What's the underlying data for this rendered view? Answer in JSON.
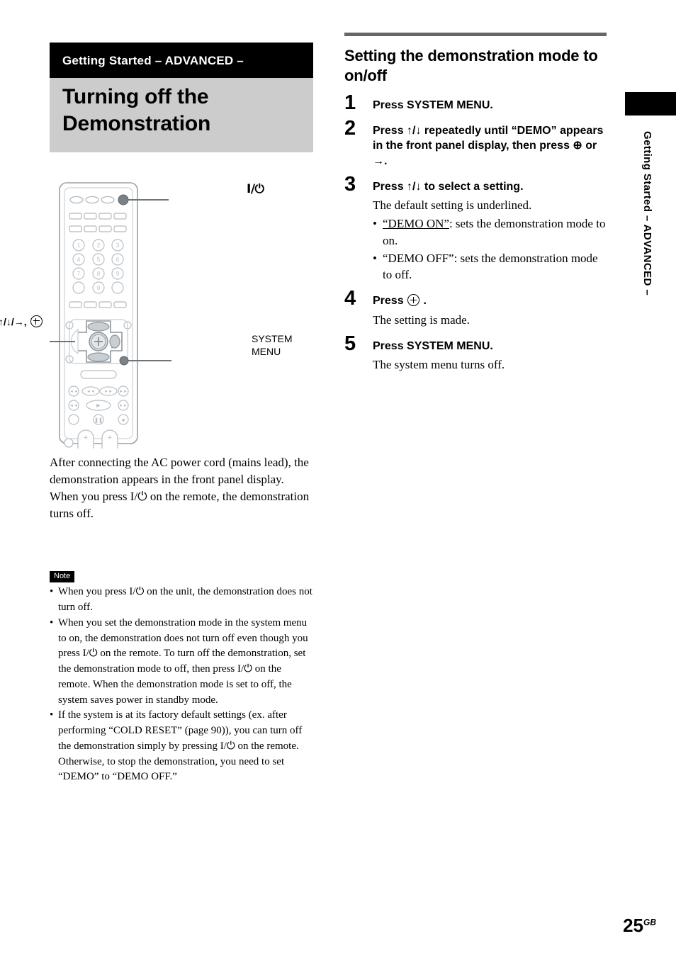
{
  "left": {
    "chapter_band": "Getting Started – ADVANCED –",
    "page_title": "Turning off the Demonstration",
    "remote_callouts": {
      "power": "I/⏻",
      "nav": "↑/↓/→,",
      "system_menu_line1": "SYSTEM",
      "system_menu_line2": "MENU"
    },
    "intro_paragraph": "After connecting the AC power cord (mains lead), the demonstration appears in the front panel display. When you press I/⏻ on the remote, the demonstration turns off.",
    "note_badge": "Note",
    "notes": [
      "When you press I/⏻ on the unit, the demonstration does not turn off.",
      "When you set the demonstration mode in the system menu to on, the demonstration does not turn off even though you press I/⏻ on the remote. To turn off the demonstration, set the demonstration mode to off, then press I/⏻ on the remote. When the demonstration mode is set to off, the system saves power in standby mode.",
      "If the system is at its factory default settings (ex. after performing “COLD RESET” (page 90)), you can turn off the demonstration simply by pressing I/⏻ on the remote. Otherwise, to stop the demonstration, you need to set “DEMO” to “DEMO OFF.”"
    ]
  },
  "right": {
    "section_heading": "Setting the demonstration mode to on/off",
    "steps": [
      {
        "num": "1",
        "head": "Press SYSTEM MENU.",
        "body": "",
        "bullets": []
      },
      {
        "num": "2",
        "head": "Press ↑/↓ repeatedly until “DEMO” appears in the front panel display, then press ⊕ or →.",
        "body": "",
        "bullets": []
      },
      {
        "num": "3",
        "head": "Press ↑/↓ to select a setting.",
        "body": "The default setting is underlined.",
        "bullets": [
          "“DEMO ON”: sets the demonstration mode to on.",
          "“DEMO OFF”: sets the demonstration mode to off."
        ]
      },
      {
        "num": "4",
        "head": "Press ⊕ .",
        "body": "The setting is made.",
        "bullets": []
      },
      {
        "num": "5",
        "head": "Press SYSTEM MENU.",
        "body": "The system menu turns off.",
        "bullets": []
      }
    ]
  },
  "edge_tab": {
    "label": "Getting Started – ADVANCED –"
  },
  "footer": {
    "page_number": "25",
    "page_suffix": "GB"
  },
  "colors": {
    "chapter_band_bg": "#000000",
    "title_band_bg": "#cccccc",
    "rule_bar": "#666666",
    "remote_outline": "#9aa0a6"
  }
}
